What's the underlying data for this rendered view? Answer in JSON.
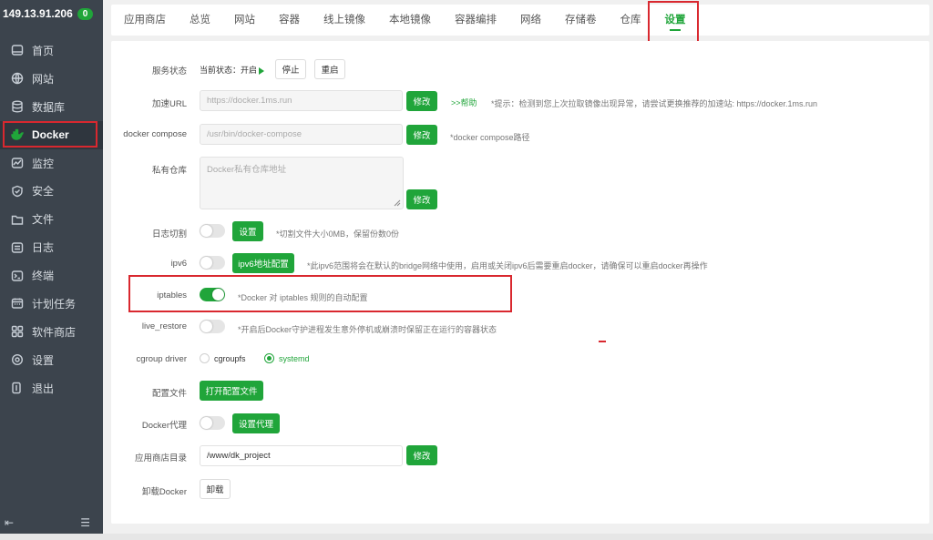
{
  "sidebar": {
    "ip": "149.13.91.206",
    "badge": "0",
    "items": [
      {
        "label": "首页",
        "icon": "home-icon"
      },
      {
        "label": "网站",
        "icon": "globe-icon"
      },
      {
        "label": "数据库",
        "icon": "database-icon"
      },
      {
        "label": "Docker",
        "icon": "docker-icon"
      },
      {
        "label": "监控",
        "icon": "monitor-icon"
      },
      {
        "label": "安全",
        "icon": "shield-icon"
      },
      {
        "label": "文件",
        "icon": "folder-icon"
      },
      {
        "label": "日志",
        "icon": "log-icon"
      },
      {
        "label": "终端",
        "icon": "terminal-icon"
      },
      {
        "label": "计划任务",
        "icon": "calendar-icon"
      },
      {
        "label": "软件商店",
        "icon": "grid-icon"
      },
      {
        "label": "设置",
        "icon": "gear-icon"
      },
      {
        "label": "退出",
        "icon": "logout-icon"
      }
    ],
    "footer_left": "⇤",
    "footer_right": "☰"
  },
  "tabs": [
    "应用商店",
    "总览",
    "网站",
    "容器",
    "线上镜像",
    "本地镜像",
    "容器编排",
    "网络",
    "存储卷",
    "仓库",
    "设置"
  ],
  "settings": {
    "service_status": {
      "label": "服务状态",
      "current": "当前状态：开启",
      "stop": "停止",
      "restart": "重启"
    },
    "accel_url": {
      "label": "加速URL",
      "placeholder": "https://docker.1ms.run",
      "button": "修改",
      "help": ">>帮助",
      "tip": "*提示：检测到您上次拉取镜像出现异常，请尝试更换推荐的加速站: https://docker.1ms.run"
    },
    "compose": {
      "label": "docker compose",
      "placeholder": "/usr/bin/docker-compose",
      "button": "修改",
      "tip": "*docker compose路径"
    },
    "registry": {
      "label": "私有仓库",
      "placeholder": "Docker私有仓库地址",
      "button": "修改"
    },
    "log_cut": {
      "label": "日志切割",
      "button": "设置",
      "tip": "*切割文件大小0MB，保留份数0份"
    },
    "ipv6": {
      "label": "ipv6",
      "button": "ipv6地址配置",
      "tip": "*此ipv6范围将会在默认的bridge网络中使用，启用或关闭ipv6后需要重启docker，请确保可以重启docker再操作"
    },
    "iptables": {
      "label": "iptables",
      "tip": "*Docker 对 iptables 规则的自动配置",
      "enabled": true
    },
    "live_restore": {
      "label": "live_restore",
      "tip": "*开启后Docker守护进程发生意外停机或崩溃时保留正在运行的容器状态"
    },
    "cgroup": {
      "label": "cgroup driver",
      "opt1": "cgroupfs",
      "opt2": "systemd",
      "selected": "systemd"
    },
    "config_file": {
      "label": "配置文件",
      "button": "打开配置文件"
    },
    "proxy": {
      "label": "Docker代理",
      "button": "设置代理"
    },
    "store_dir": {
      "label": "应用商店目录",
      "value": "/www/dk_project",
      "button": "修改"
    },
    "uninstall": {
      "label": "卸载Docker",
      "button": "卸载"
    }
  },
  "colors": {
    "accent": "#20a53a",
    "sidebar_bg": "#3c444d",
    "highlight": "#d9282f"
  }
}
